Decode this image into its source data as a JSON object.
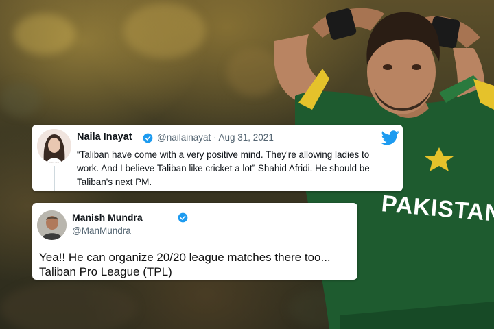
{
  "background": {
    "shirt_text": "PAKISTAN",
    "colors": {
      "jersey_green": "#1e5b2f",
      "jersey_yellow": "#e5c22b",
      "skin": "#b98462",
      "hair": "#2a1d14"
    }
  },
  "tweet1": {
    "name": "Naila Inayat",
    "handle_date": "@nailainayat · Aug 31, 2021",
    "text": "“Taliban have come with a very positive mind. They're allowing ladies to work. And I believe Taliban like cricket a lot” Shahid Afridi. He should be Taliban's next PM.",
    "icons": {
      "verified": "verified-badge-icon",
      "brand": "twitter-bird-icon"
    },
    "colors": {
      "verified": "#1d9bf0",
      "bird": "#1d9bf0"
    }
  },
  "tweet2": {
    "name": "Manish Mundra",
    "handle": "@ManMundra",
    "text_line1": "Yea!! He can organize 20/20 league matches there too...",
    "text_line2": "Taliban Pro League (TPL)",
    "icons": {
      "verified": "verified-badge-icon"
    }
  }
}
